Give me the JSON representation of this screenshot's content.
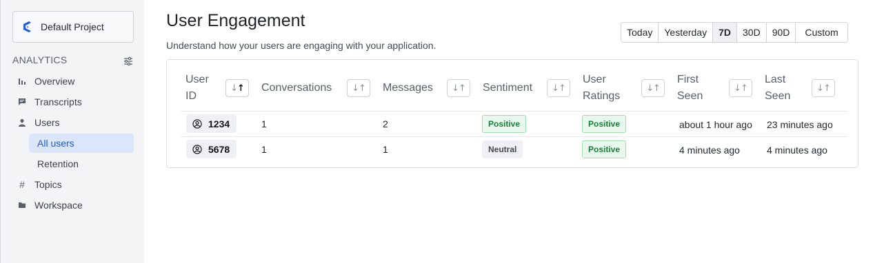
{
  "sidebar": {
    "project_name": "Default Project",
    "section_title": "ANALYTICS",
    "items": [
      {
        "label": "Overview",
        "icon": "bar-chart-icon"
      },
      {
        "label": "Transcripts",
        "icon": "chat-icon"
      },
      {
        "label": "Users",
        "icon": "user-icon"
      },
      {
        "label": "Topics",
        "icon": "hash-icon"
      },
      {
        "label": "Workspace",
        "icon": "folder-icon"
      }
    ],
    "sub_items": [
      {
        "label": "All users",
        "active": true
      },
      {
        "label": "Retention",
        "active": false
      }
    ]
  },
  "header": {
    "title": "User Engagement",
    "subtitle": "Understand how your users are engaging with your application."
  },
  "range": {
    "options": [
      "Today",
      "Yesterday",
      "7D",
      "30D",
      "90D",
      "Custom"
    ],
    "selected": "7D"
  },
  "table": {
    "columns": [
      {
        "label_line1": "User",
        "label_line2": "ID",
        "sort_active": true
      },
      {
        "label_line1": "Conversations",
        "label_line2": "",
        "sort_active": false
      },
      {
        "label_line1": "Messages",
        "label_line2": "",
        "sort_active": false
      },
      {
        "label_line1": "Sentiment",
        "label_line2": "",
        "sort_active": false
      },
      {
        "label_line1": "User",
        "label_line2": "Ratings",
        "sort_active": false
      },
      {
        "label_line1": "First",
        "label_line2": "Seen",
        "sort_active": false
      },
      {
        "label_line1": "Last",
        "label_line2": "Seen",
        "sort_active": false
      }
    ],
    "sort_glyph": "↓↑",
    "rows": [
      {
        "user_id": "1234",
        "conversations": "1",
        "messages": "2",
        "sentiment": "Positive",
        "rating": "Positive",
        "first_seen": "about 1 hour ago",
        "last_seen": "23 minutes ago"
      },
      {
        "user_id": "5678",
        "conversations": "1",
        "messages": "1",
        "sentiment": "Neutral",
        "rating": "Positive",
        "first_seen": "4 minutes ago",
        "last_seen": "4 minutes ago"
      }
    ]
  },
  "colors": {
    "accent": "#1f5bd6",
    "positive_bg": "#e9f8ec",
    "positive_text": "#1a7f37",
    "neutral_bg": "#eef0f3"
  }
}
